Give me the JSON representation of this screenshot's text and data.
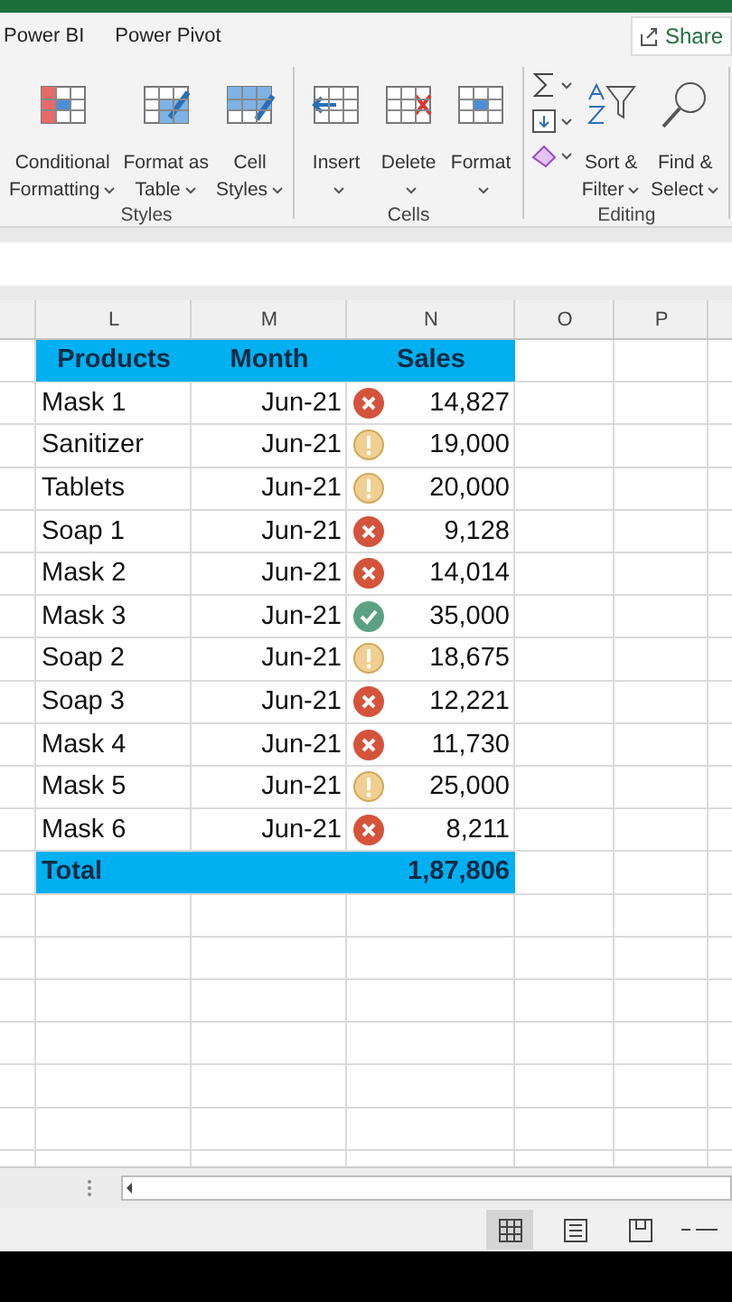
{
  "tabs": [
    {
      "label": "Power BI",
      "selected": false
    },
    {
      "label": "Power Pivot",
      "selected": false
    }
  ],
  "share_button": {
    "label": "Share"
  },
  "ribbon_groups": [
    {
      "name": "Styles",
      "commands": [
        {
          "kind": "cf",
          "lines": [
            "Conditional",
            "Formatting"
          ]
        },
        {
          "kind": "table",
          "lines": [
            "Format as",
            "Table"
          ]
        },
        {
          "kind": "styles",
          "lines": [
            "Cell",
            "Styles"
          ]
        }
      ]
    },
    {
      "name": "Cells",
      "commands": [
        {
          "kind": "insert",
          "lines": [
            "Insert"
          ]
        },
        {
          "kind": "delete",
          "lines": [
            "Delete"
          ]
        },
        {
          "kind": "format",
          "lines": [
            "Format"
          ]
        }
      ]
    },
    {
      "name": "Editing",
      "commands": [
        {
          "kind": "smalls"
        },
        {
          "kind": "sort",
          "lines": [
            "Sort &",
            "Filter"
          ]
        },
        {
          "kind": "find",
          "lines": [
            "Find &",
            "Select"
          ]
        }
      ]
    }
  ],
  "columns": [
    "L",
    "M",
    "N",
    "O",
    "P"
  ],
  "table": {
    "headers": [
      "Products",
      "Month",
      "Sales"
    ],
    "rows": [
      {
        "product": "Mask 1",
        "month": "Jun-21",
        "kind": "bad",
        "sales": "14,827"
      },
      {
        "product": "Sanitizer",
        "month": "Jun-21",
        "kind": "warn",
        "sales": "19,000"
      },
      {
        "product": "Tablets",
        "month": "Jun-21",
        "kind": "warn",
        "sales": "20,000"
      },
      {
        "product": "Soap 1",
        "month": "Jun-21",
        "kind": "bad",
        "sales": "9,128"
      },
      {
        "product": "Mask 2",
        "month": "Jun-21",
        "kind": "bad",
        "sales": "14,014"
      },
      {
        "product": "Mask 3",
        "month": "Jun-21",
        "kind": "good",
        "sales": "35,000"
      },
      {
        "product": "Soap 2",
        "month": "Jun-21",
        "kind": "warn",
        "sales": "18,675"
      },
      {
        "product": "Soap 3",
        "month": "Jun-21",
        "kind": "bad",
        "sales": "12,221"
      },
      {
        "product": "Mask 4",
        "month": "Jun-21",
        "kind": "bad",
        "sales": "11,730"
      },
      {
        "product": "Mask 5",
        "month": "Jun-21",
        "kind": "warn",
        "sales": "25,000"
      },
      {
        "product": "Mask 6",
        "month": "Jun-21",
        "kind": "bad",
        "sales": "8,211"
      }
    ],
    "total": {
      "label": "Total",
      "value": "1,87,806"
    }
  },
  "status_bar": {
    "views": [
      {
        "kind": "normal",
        "selected": true
      },
      {
        "kind": "layout",
        "selected": false
      },
      {
        "kind": "break",
        "selected": false
      }
    ]
  }
}
